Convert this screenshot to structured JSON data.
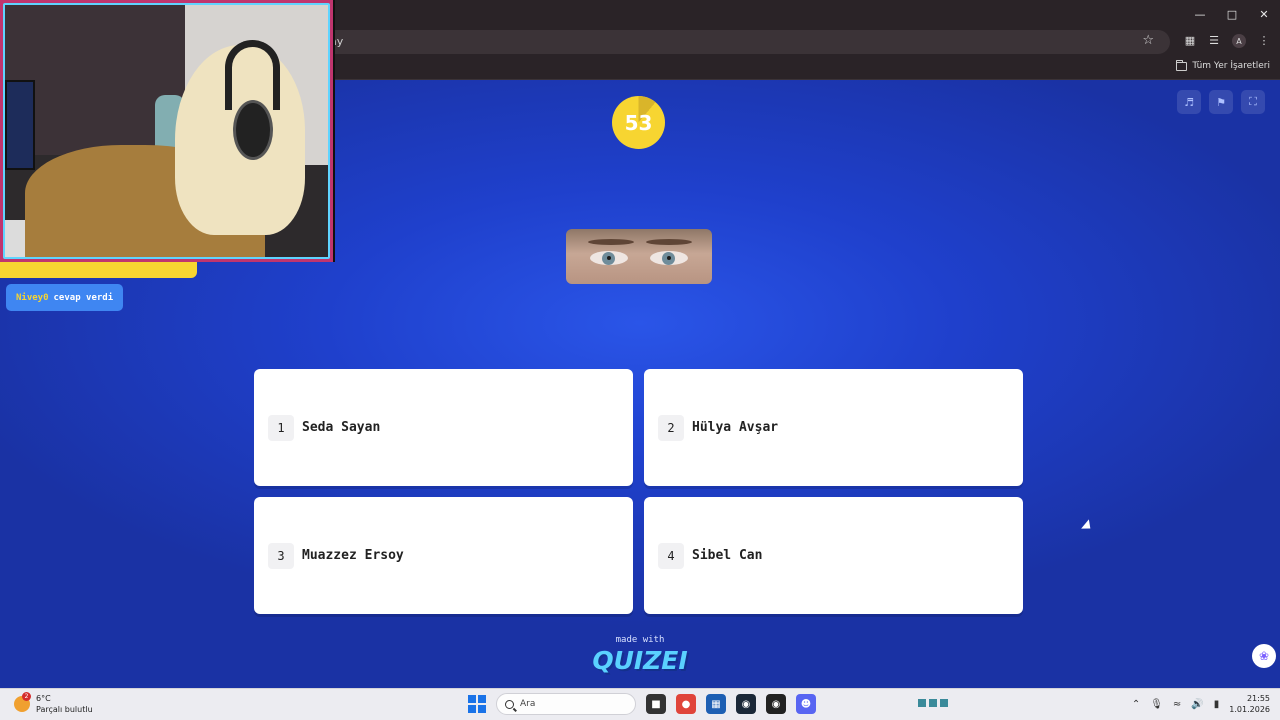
{
  "browser": {
    "url_text": "ay",
    "bookmarks_all_label": "Tüm Yer İşaretleri",
    "profile_initial": "A",
    "window_controls": [
      "minimize-icon",
      "maximize-icon",
      "close-icon"
    ]
  },
  "quiz": {
    "timer": "53",
    "controls": [
      "sound-icon",
      "flag-icon",
      "fullscreen-icon"
    ],
    "answers": [
      {
        "num": "1",
        "text": "Seda Sayan"
      },
      {
        "num": "2",
        "text": "Hülya Avşar"
      },
      {
        "num": "3",
        "text": "Muazzez Ersoy"
      },
      {
        "num": "4",
        "text": "Sibel Can"
      }
    ],
    "made_with": "made with",
    "logo": "QUIZEI"
  },
  "overlay": {
    "answered_user": "Nivey0",
    "answered_text": "cevap verdi"
  },
  "taskbar": {
    "weather_temp": "6°C",
    "weather_desc": "Parçalı bulutlu",
    "weather_badge": "2",
    "search_placeholder": "Ara",
    "clock_time": "21:55",
    "clock_date": "1.01.2026"
  },
  "colors": {
    "page_bg": "#1f40cc",
    "timer": "#f7d531",
    "webcam_frame": "#c0356e",
    "answered_badge": "#3f86f2",
    "logo": "#5ad1ff"
  }
}
